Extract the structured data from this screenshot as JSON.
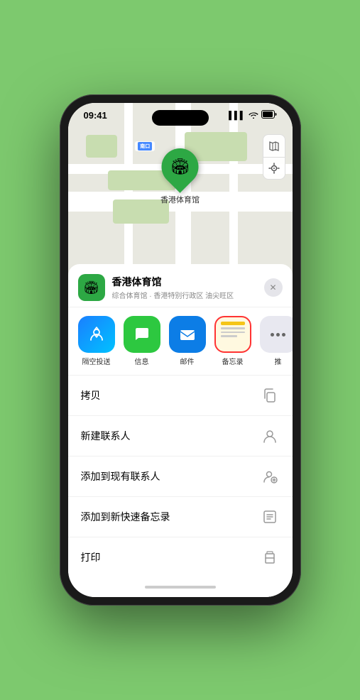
{
  "status_bar": {
    "time": "09:41",
    "signal": "▌▌▌",
    "wifi": "wifi",
    "battery": "battery"
  },
  "map": {
    "road_label": "南口",
    "venue_marker_label": "香港体育馆",
    "venue_marker_emoji": "🏟"
  },
  "sheet": {
    "venue_name": "香港体育馆",
    "venue_description": "综合体育馆 · 香港特别行政区 油尖旺区",
    "close_label": "✕"
  },
  "share_items": [
    {
      "id": "airdrop",
      "label": "隔空投送",
      "type": "airdrop"
    },
    {
      "id": "message",
      "label": "信息",
      "type": "message"
    },
    {
      "id": "mail",
      "label": "邮件",
      "type": "mail"
    },
    {
      "id": "notes",
      "label": "备忘录",
      "type": "notes"
    },
    {
      "id": "more",
      "label": "推",
      "type": "more"
    }
  ],
  "actions": [
    {
      "id": "copy",
      "label": "拷贝",
      "icon": "copy"
    },
    {
      "id": "new-contact",
      "label": "新建联系人",
      "icon": "person"
    },
    {
      "id": "add-existing",
      "label": "添加到现有联系人",
      "icon": "person-add"
    },
    {
      "id": "add-notes",
      "label": "添加到新快速备忘录",
      "icon": "note"
    },
    {
      "id": "print",
      "label": "打印",
      "icon": "print"
    }
  ],
  "map_controls": [
    {
      "id": "map-type",
      "icon": "🗺"
    },
    {
      "id": "location",
      "icon": "➤"
    }
  ]
}
